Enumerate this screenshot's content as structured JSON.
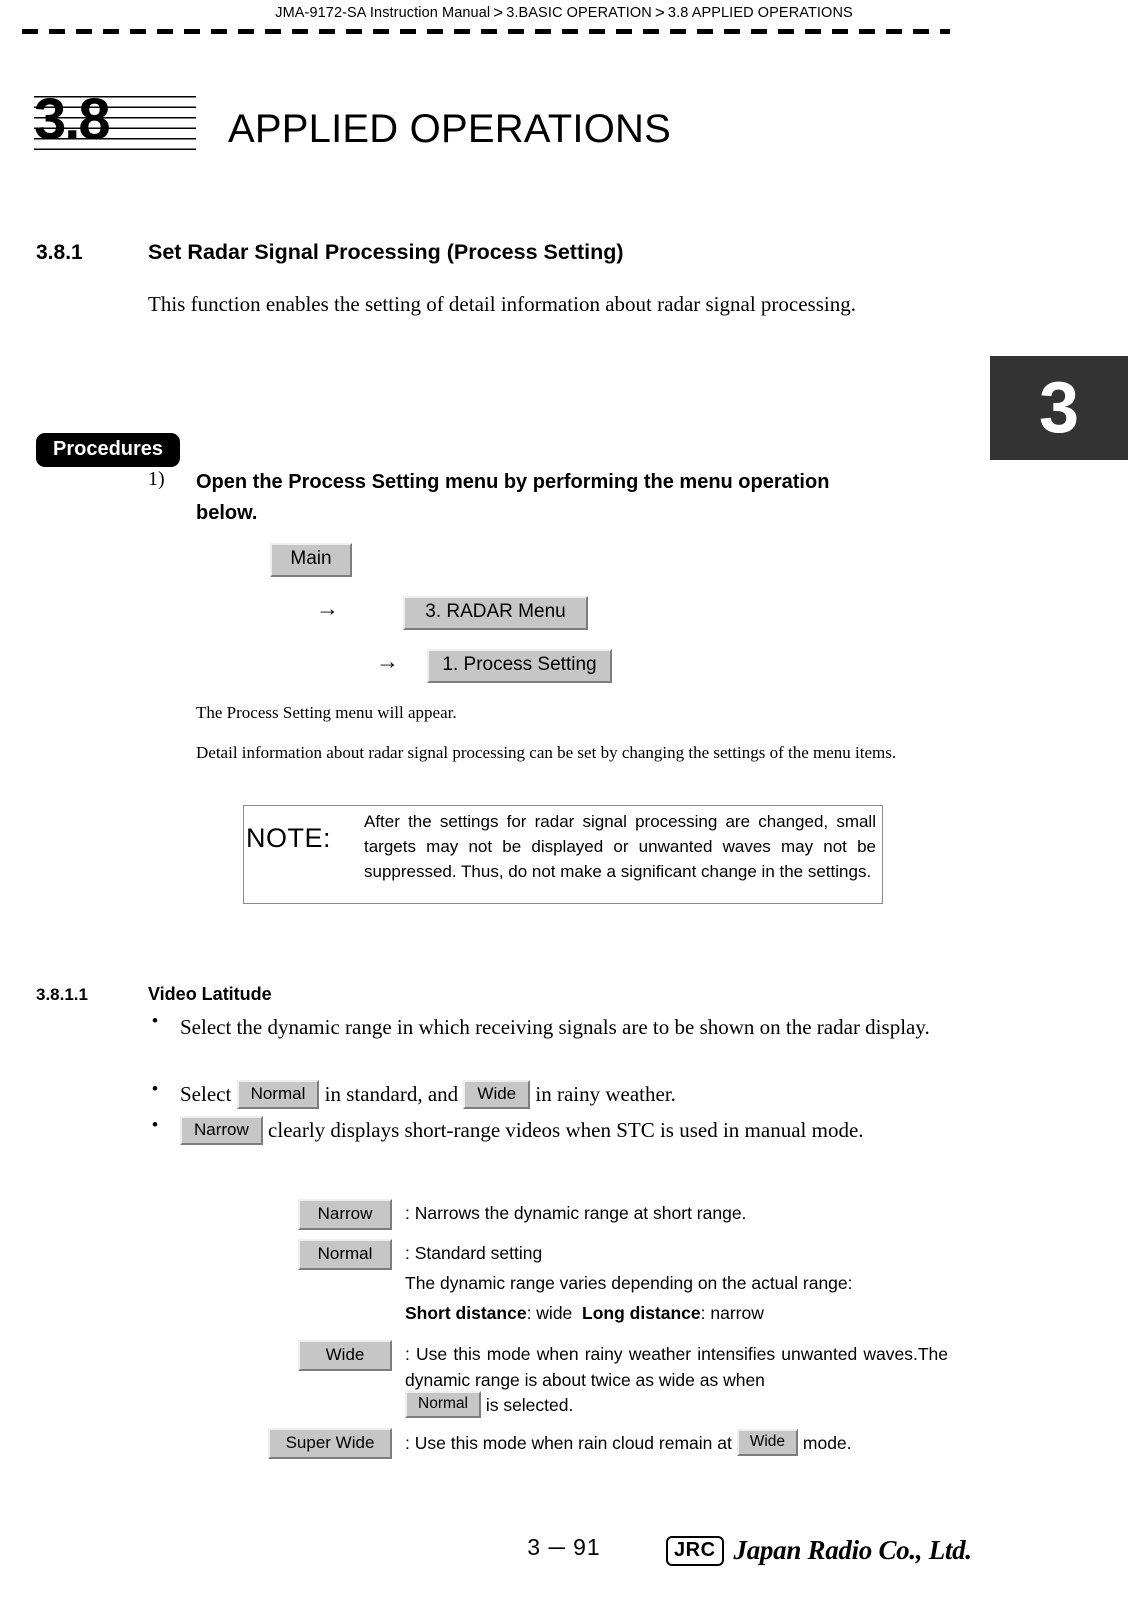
{
  "header": {
    "breadcrumb_1": "JMA-9172-SA Instruction Manual",
    "separator": ">",
    "breadcrumb_2": "3.BASIC OPERATION",
    "breadcrumb_3": "3.8  APPLIED OPERATIONS"
  },
  "chapter_tab": {
    "label": "3"
  },
  "section": {
    "number": "3.8",
    "title": "APPLIED OPERATIONS"
  },
  "subsection": {
    "number": "3.8.1",
    "title": "Set Radar Signal Processing (Process Setting)",
    "intro": "This function enables the setting of detail information about radar signal processing."
  },
  "procedures": {
    "pill_label": "Procedures",
    "step_number": "1)",
    "step_text": "Open the Process Setting menu by performing the menu operation below.",
    "menu_path": [
      {
        "label": "Main",
        "arrow": ""
      },
      {
        "label": "3. RADAR Menu",
        "arrow": "→"
      },
      {
        "label": "1. Process Setting",
        "arrow": "→"
      }
    ],
    "after_text": "The Process Setting menu will appear.",
    "detail_text": "Detail information about radar signal processing can be set by changing the settings of the menu items."
  },
  "note": {
    "label": "NOTE:",
    "text": "After the settings for radar signal processing are changed, small targets may not be displayed or unwanted waves may not be suppressed. Thus, do not make a significant change in the settings."
  },
  "video_latitude": {
    "number": "3.8.1.1",
    "title": "Video Latitude",
    "bullets": [
      {
        "parts": [
          {
            "type": "text",
            "value": "Select the dynamic range in which receiving signals are to be shown on the radar display."
          }
        ]
      },
      {
        "parts": [
          {
            "type": "text",
            "value": "Select "
          },
          {
            "type": "button",
            "value": "Normal"
          },
          {
            "type": "text",
            "value": " in standard, and "
          },
          {
            "type": "button",
            "value": "Wide"
          },
          {
            "type": "text",
            "value": " in rainy weather."
          }
        ]
      },
      {
        "parts": [
          {
            "type": "button",
            "value": "Narrow"
          },
          {
            "type": "text",
            "value": " clearly displays short-range videos when STC is used in manual mode."
          }
        ]
      }
    ],
    "definitions": [
      {
        "button": "Narrow",
        "lines": [
          {
            "text": ": Narrows the dynamic range at short range."
          }
        ]
      },
      {
        "button": "Normal",
        "lines": [
          {
            "text": ": Standard setting"
          },
          {
            "text": "The dynamic range varies depending on the actual range:"
          },
          {
            "text": "Short distance: wide  Long distance: narrow",
            "bold_runs": [
              "Short distance",
              "Long distance"
            ]
          }
        ]
      },
      {
        "button": "Wide",
        "lines": [
          {
            "text": ": Use this mode when rainy weather intensifies unwanted waves.The dynamic range is about twice as wide as when"
          },
          {
            "inline_button": "Normal",
            "text": " is selected."
          }
        ]
      },
      {
        "button": "Super Wide",
        "lines": [
          {
            "text_before": ": Use this mode when rain cloud remain at ",
            "inline_button": "Wide",
            "text_after": " mode."
          }
        ]
      }
    ]
  },
  "footer": {
    "page_number": "3 ─ 91",
    "logo_mark": "JRC",
    "logo_name": "Japan Radio Co., Ltd."
  }
}
